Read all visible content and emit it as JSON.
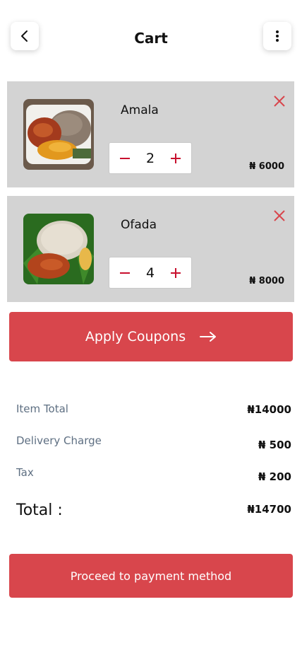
{
  "header": {
    "title": "Cart"
  },
  "items": [
    {
      "name": "Amala",
      "quantity": "2",
      "price": "₦ 6000"
    },
    {
      "name": "Ofada",
      "quantity": "4",
      "price": "₦ 8000"
    }
  ],
  "coupon": {
    "label": "Apply Coupons"
  },
  "summary": {
    "item_total_label": "Item Total",
    "item_total_value": "₦14000",
    "delivery_label": "Delivery Charge",
    "delivery_value": "₦ 500",
    "tax_label": "Tax",
    "tax_value": "₦ 200",
    "total_label": "Total :",
    "total_value": "₦14700"
  },
  "payment": {
    "label": "Proceed to payment method"
  },
  "colors": {
    "accent": "#d8464c",
    "card_bg": "#d3d3d3",
    "muted_text": "#5e6f82"
  }
}
